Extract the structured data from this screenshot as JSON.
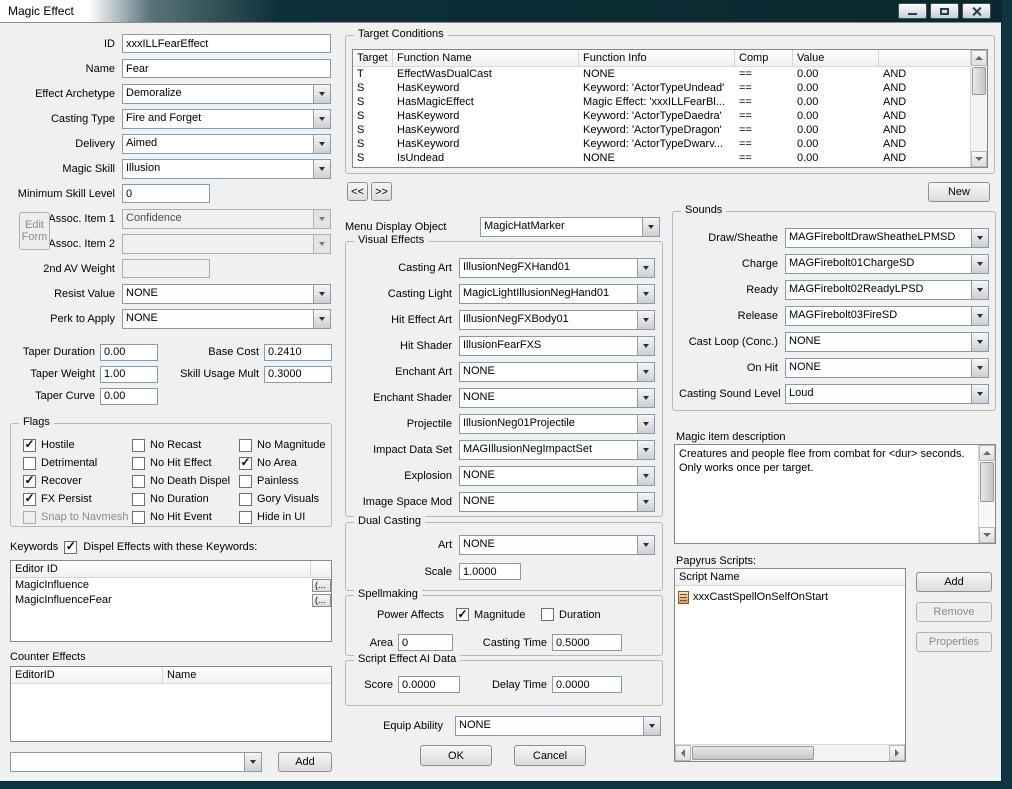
{
  "window": {
    "title": "Magic Effect"
  },
  "general": {
    "id": {
      "label": "ID",
      "value": "xxxILLFearEffect"
    },
    "name": {
      "label": "Name",
      "value": "Fear"
    },
    "effect_archetype": {
      "label": "Effect Archetype",
      "value": "Demoralize"
    },
    "casting_type": {
      "label": "Casting Type",
      "value": "Fire and Forget"
    },
    "delivery": {
      "label": "Delivery",
      "value": "Aimed"
    },
    "magic_skill": {
      "label": "Magic Skill",
      "value": "Illusion"
    },
    "minimum_skill_level": {
      "label": "Minimum Skill Level",
      "value": "0"
    },
    "edit_form_button": "Edit Form",
    "assoc_item_1": {
      "label": "Assoc. Item 1",
      "value": "Confidence"
    },
    "assoc_item_2": {
      "label": "Assoc. Item 2",
      "value": ""
    },
    "second_av_weight": {
      "label": "2nd AV Weight",
      "value": ""
    },
    "resist_value": {
      "label": "Resist Value",
      "value": "NONE"
    },
    "perk_to_apply": {
      "label": "Perk to Apply",
      "value": "NONE"
    },
    "taper_duration": {
      "label": "Taper Duration",
      "value": "0.00"
    },
    "base_cost": {
      "label": "Base Cost",
      "value": "0.2410"
    },
    "taper_weight": {
      "label": "Taper Weight",
      "value": "1.00"
    },
    "skill_usage_mult": {
      "label": "Skill Usage Mult",
      "value": "0.3000"
    },
    "taper_curve": {
      "label": "Taper Curve",
      "value": "0.00"
    }
  },
  "flags": {
    "title": "Flags",
    "col1": [
      {
        "label": "Hostile",
        "checked": true,
        "disabled": false
      },
      {
        "label": "Detrimental",
        "checked": false,
        "disabled": false
      },
      {
        "label": "Recover",
        "checked": true,
        "disabled": false
      },
      {
        "label": "FX Persist",
        "checked": true,
        "disabled": false
      },
      {
        "label": "Snap to Navmesh",
        "checked": false,
        "disabled": true
      }
    ],
    "col2": [
      {
        "label": "No Recast",
        "checked": false,
        "disabled": false
      },
      {
        "label": "No Hit Effect",
        "checked": false,
        "disabled": false
      },
      {
        "label": "No Death Dispel",
        "checked": false,
        "disabled": false
      },
      {
        "label": "No Duration",
        "checked": false,
        "disabled": false
      },
      {
        "label": "No Hit Event",
        "checked": false,
        "disabled": false
      }
    ],
    "col3": [
      {
        "label": "No Magnitude",
        "checked": false,
        "disabled": false
      },
      {
        "label": "No Area",
        "checked": true,
        "disabled": false
      },
      {
        "label": "Painless",
        "checked": false,
        "disabled": false
      },
      {
        "label": "Gory Visuals",
        "checked": false,
        "disabled": false
      },
      {
        "label": "Hide in UI",
        "checked": false,
        "disabled": false
      }
    ]
  },
  "keywords": {
    "label": "Keywords",
    "dispel": {
      "label": "Dispel Effects with these Keywords:",
      "checked": true
    },
    "column": "Editor ID",
    "items": [
      {
        "name": "MagicInfluence",
        "more": "(..."
      },
      {
        "name": "MagicInfluenceFear",
        "more": "(..."
      }
    ]
  },
  "counter_effects": {
    "label": "Counter Effects",
    "columns": [
      "EditorID",
      "Name"
    ],
    "picker_value": "",
    "add_button": "Add"
  },
  "conditions": {
    "title": "Target Conditions",
    "columns": [
      "Target",
      "Function Name",
      "Function Info",
      "Comp",
      "Value"
    ],
    "rows": [
      {
        "target": "T",
        "function": "EffectWasDualCast",
        "info": "NONE",
        "comp": "==",
        "value": "0.00",
        "op": "AND"
      },
      {
        "target": "S",
        "function": "HasKeyword",
        "info": "Keyword: 'ActorTypeUndead'",
        "comp": "==",
        "value": "0.00",
        "op": "AND"
      },
      {
        "target": "S",
        "function": "HasMagicEffect",
        "info": "Magic Effect: 'xxxILLFearBl...",
        "comp": "==",
        "value": "0.00",
        "op": "AND"
      },
      {
        "target": "S",
        "function": "HasKeyword",
        "info": "Keyword: 'ActorTypeDaedra'",
        "comp": "==",
        "value": "0.00",
        "op": "AND"
      },
      {
        "target": "S",
        "function": "HasKeyword",
        "info": "Keyword: 'ActorTypeDragon'",
        "comp": "==",
        "value": "0.00",
        "op": "AND"
      },
      {
        "target": "S",
        "function": "HasKeyword",
        "info": "Keyword: 'ActorTypeDwarv...",
        "comp": "==",
        "value": "0.00",
        "op": "AND"
      },
      {
        "target": "S",
        "function": "IsUndead",
        "info": "NONE",
        "comp": "==",
        "value": "0.00",
        "op": "AND"
      }
    ],
    "prev_button": "<<",
    "next_button": ">>",
    "new_button": "New"
  },
  "menu_display_object": {
    "label": "Menu Display Object",
    "value": "MagicHatMarker"
  },
  "visual_effects": {
    "title": "Visual Effects",
    "rows": [
      {
        "label": "Casting Art",
        "value": "IllusionNegFXHand01"
      },
      {
        "label": "Casting Light",
        "value": "MagicLightIllusionNegHand01"
      },
      {
        "label": "Hit Effect Art",
        "value": "IllusionNegFXBody01"
      },
      {
        "label": "Hit Shader",
        "value": "IllusionFearFXS"
      },
      {
        "label": "Enchant Art",
        "value": "NONE"
      },
      {
        "label": "Enchant Shader",
        "value": "NONE"
      },
      {
        "label": "Projectile",
        "value": "IllusionNeg01Projectile"
      },
      {
        "label": "Impact Data Set",
        "value": "MAGIllusionNegImpactSet"
      },
      {
        "label": "Explosion",
        "value": "NONE"
      },
      {
        "label": "Image Space Mod",
        "value": "NONE"
      }
    ]
  },
  "dual_casting": {
    "title": "Dual Casting",
    "art": {
      "label": "Art",
      "value": "NONE"
    },
    "scale": {
      "label": "Scale",
      "value": "1.0000"
    }
  },
  "spellmaking": {
    "title": "Spellmaking",
    "power_affects_label": "Power Affects",
    "magnitude": {
      "label": "Magnitude",
      "checked": true
    },
    "duration": {
      "label": "Duration",
      "checked": false
    },
    "area": {
      "label": "Area",
      "value": "0"
    },
    "casting_time": {
      "label": "Casting Time",
      "value": "0.5000"
    }
  },
  "script_ai": {
    "title": "Script Effect AI Data",
    "score": {
      "label": "Score",
      "value": "0.0000"
    },
    "delay_time": {
      "label": "Delay Time",
      "value": "0.0000"
    }
  },
  "equip_ability": {
    "label": "Equip Ability",
    "value": "NONE"
  },
  "actions": {
    "ok": "OK",
    "cancel": "Cancel"
  },
  "sounds": {
    "title": "Sounds",
    "rows": [
      {
        "label": "Draw/Sheathe",
        "value": "MAGFireboltDrawSheatheLPMSD"
      },
      {
        "label": "Charge",
        "value": "MAGFirebolt01ChargeSD"
      },
      {
        "label": "Ready",
        "value": "MAGFirebolt02ReadyLPSD"
      },
      {
        "label": "Release",
        "value": "MAGFirebolt03FireSD"
      },
      {
        "label": "Cast Loop (Conc.)",
        "value": "NONE"
      },
      {
        "label": "On Hit",
        "value": "NONE"
      },
      {
        "label": "Casting Sound Level",
        "value": "Loud"
      }
    ]
  },
  "description": {
    "label": "Magic item description",
    "text": "Creatures and people flee from combat for <dur> seconds. Only works once per target."
  },
  "papyrus": {
    "label": "Papyrus Scripts:",
    "column": "Script Name",
    "scripts": [
      {
        "name": "xxxCastSpellOnSelfOnStart"
      }
    ],
    "buttons": {
      "add": "Add",
      "remove": "Remove",
      "properties": "Properties"
    }
  }
}
